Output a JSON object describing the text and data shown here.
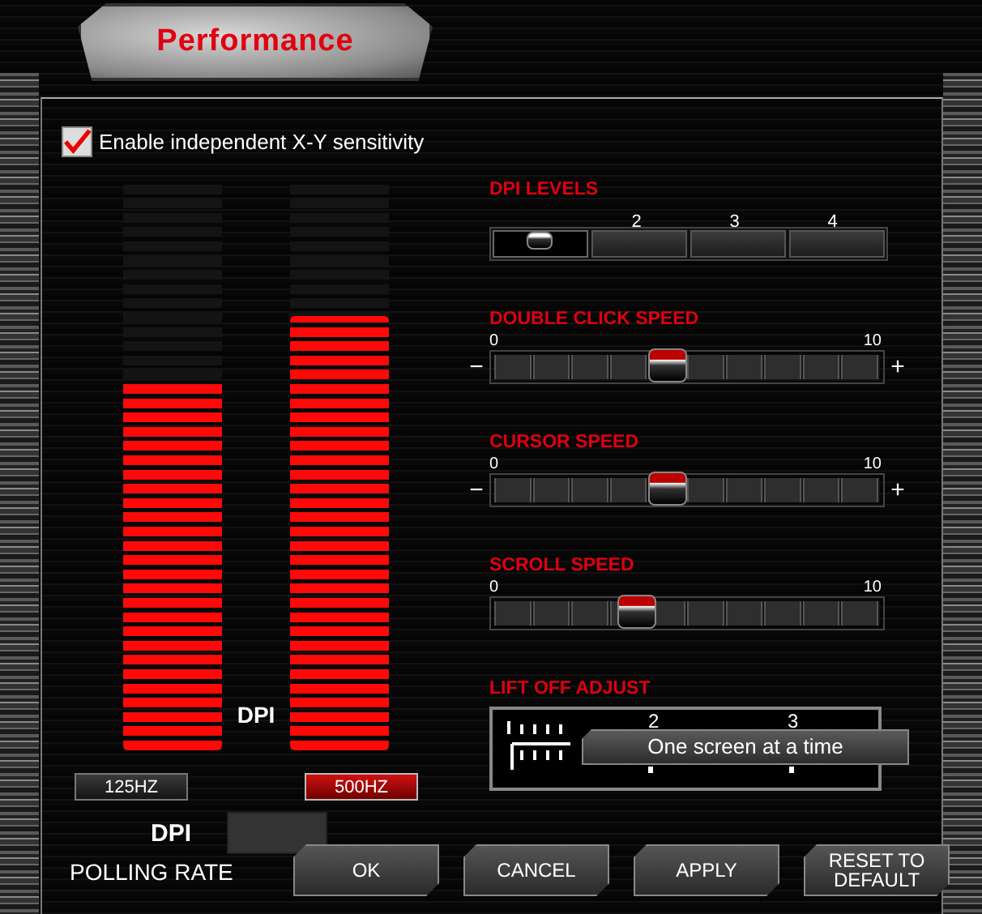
{
  "window": {
    "title": "Performance"
  },
  "xy_sensitivity": {
    "label": "Enable independent X-Y sensitivity",
    "checked": true
  },
  "dpi_bars": [
    {
      "level": 0.65
    },
    {
      "level": 0.76
    }
  ],
  "dpi_bar_label": "DPI",
  "polling_rates": [
    {
      "label": "125HZ",
      "selected": false
    },
    {
      "label": "500HZ",
      "selected": true
    }
  ],
  "dpi_field": {
    "label": "DPI"
  },
  "polling_rate_label": "POLLING RATE",
  "dpi_levels": {
    "title": "DPI LEVELS",
    "levels": [
      {
        "selected": true
      },
      {
        "label": "2",
        "selected": false
      },
      {
        "label": "3",
        "selected": false
      },
      {
        "label": "4",
        "selected": false
      }
    ]
  },
  "sliders": [
    {
      "title": "DOUBLE CLICK SPEED",
      "min": "0",
      "max": "10",
      "minus": "−",
      "plus": "+",
      "level": 0.45
    },
    {
      "title": "CURSOR SPEED",
      "min": "0",
      "max": "10",
      "minus": "−",
      "plus": "+",
      "level": 0.45
    },
    {
      "title": "SCROLL SPEED",
      "min": "0",
      "max": "10",
      "level": 0.37
    }
  ],
  "lift_off": {
    "title": "LIFT OFF ADJUST",
    "marks": [
      "2",
      "3"
    ],
    "tooltip": "One screen at a time"
  },
  "buttons": [
    "OK",
    "CANCEL",
    "APPLY",
    "RESET TO DEFAULT"
  ]
}
